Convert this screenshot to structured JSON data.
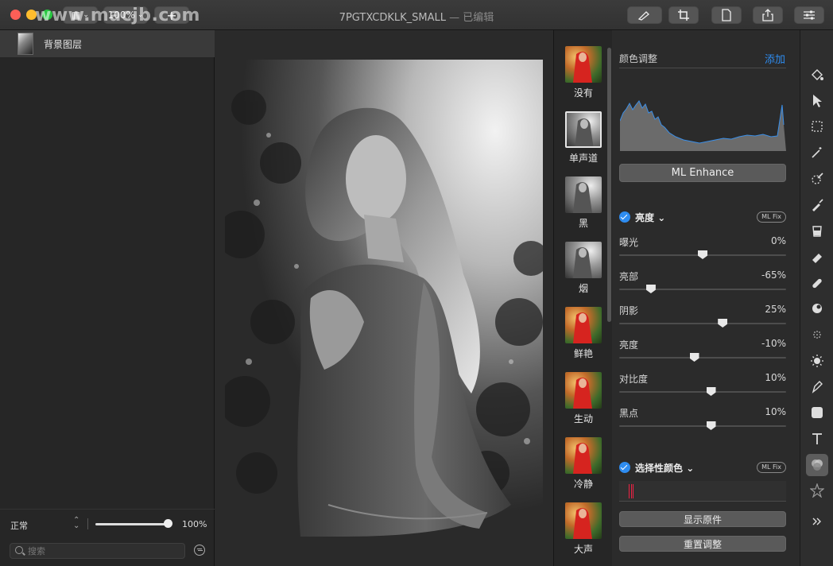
{
  "window": {
    "title": "7PGTXCDKLK_SMALL",
    "title_suffix": "— 已编辑",
    "zoom": "100%",
    "watermark": "www.macjb.com"
  },
  "toolbar": {
    "view_label": "▦",
    "add_label": "+"
  },
  "layers": {
    "items": [
      {
        "name": "背景图层"
      }
    ],
    "blend_mode": "正常",
    "opacity": "100%",
    "opacity_fraction": 1.0,
    "search_placeholder": "搜索"
  },
  "presets": [
    {
      "label": "没有",
      "style": "color",
      "selected": false
    },
    {
      "label": "单声道",
      "style": "mono",
      "selected": true
    },
    {
      "label": "黑",
      "style": "mono",
      "selected": false
    },
    {
      "label": "烟",
      "style": "mono",
      "selected": false
    },
    {
      "label": "鲜艳",
      "style": "color",
      "selected": false
    },
    {
      "label": "生动",
      "style": "color",
      "selected": false
    },
    {
      "label": "冷静",
      "style": "color",
      "selected": false
    },
    {
      "label": "大声",
      "style": "color",
      "selected": false
    }
  ],
  "adjust": {
    "title": "颜色调整",
    "add_label": "添加",
    "ml_enhance": "ML Enhance",
    "brightness_section": "亮度",
    "ml_fix": "ML Fix",
    "sliders": [
      {
        "label": "曝光",
        "value": "0%",
        "pos": 0.5
      },
      {
        "label": "亮部",
        "value": "-65%",
        "pos": 0.19
      },
      {
        "label": "阴影",
        "value": "25%",
        "pos": 0.62
      },
      {
        "label": "亮度",
        "value": "-10%",
        "pos": 0.45
      },
      {
        "label": "对比度",
        "value": "10%",
        "pos": 0.55
      },
      {
        "label": "黑点",
        "value": "10%",
        "pos": 0.55
      }
    ],
    "selective_color_section": "选择性颜色",
    "show_original": "显示原件",
    "reset": "重置调整"
  },
  "tools": [
    "paint-bucket-icon",
    "arrow-cursor-icon",
    "marquee-select-icon",
    "magic-wand-icon",
    "quick-select-icon",
    "brush-icon",
    "bucket-fill-icon",
    "eraser-icon",
    "bandage-repair-icon",
    "clone-stamp-icon",
    "blur-icon",
    "sun-icon",
    "pen-icon",
    "shape-icon",
    "text-icon",
    "color-adjust-icon",
    "star-effects-icon",
    "more-icon"
  ],
  "colors": {
    "accent": "#2e8cf0",
    "panel": "#2b2b2b",
    "sidebar": "#262626",
    "canvas": "#2a2a2a"
  }
}
